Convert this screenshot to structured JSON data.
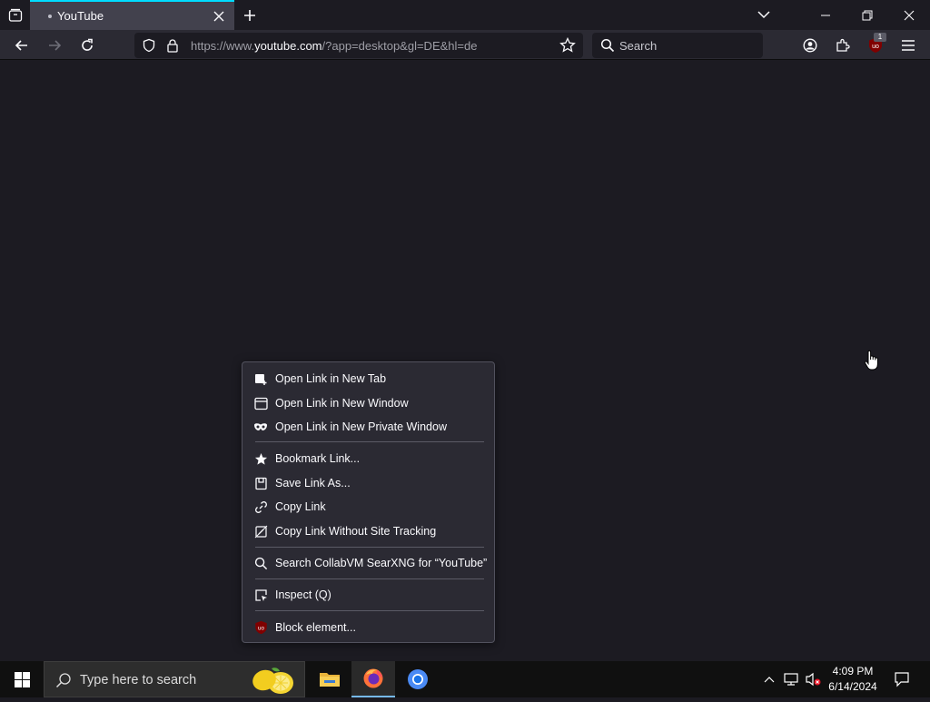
{
  "browser": {
    "tab": {
      "title": "YouTube"
    },
    "url": {
      "prefix": "https://www.",
      "host": "youtube.com",
      "rest": "/?app=desktop&gl=DE&hl=de"
    },
    "search_placeholder": "Search",
    "extension_badge": "1"
  },
  "context_menu": {
    "items": [
      {
        "label": "Open Link in New Tab",
        "icon": "new-tab-icon"
      },
      {
        "label": "Open Link in New Window",
        "icon": "window-icon"
      },
      {
        "label": "Open Link in New Private Window",
        "icon": "private-mask-icon"
      },
      {
        "label": "Bookmark Link...",
        "icon": "star-icon"
      },
      {
        "label": "Save Link As...",
        "icon": "save-icon"
      },
      {
        "label": "Copy Link",
        "icon": "link-icon"
      },
      {
        "label": "Copy Link Without Site Tracking",
        "icon": "link-no-tracking-icon"
      },
      {
        "label": "Search CollabVM SearXNG for “YouTube”",
        "icon": "search-icon"
      },
      {
        "label": "Inspect (Q)",
        "icon": "inspect-icon"
      },
      {
        "label": "Block element...",
        "icon": "ublock-icon"
      }
    ]
  },
  "taskbar": {
    "search_placeholder": "Type here to search",
    "time": "4:09 PM",
    "date": "6/14/2024"
  },
  "colors": {
    "accent": "#00ddff",
    "ublock": "#800000",
    "taskbar_active": "#76b9ed"
  }
}
